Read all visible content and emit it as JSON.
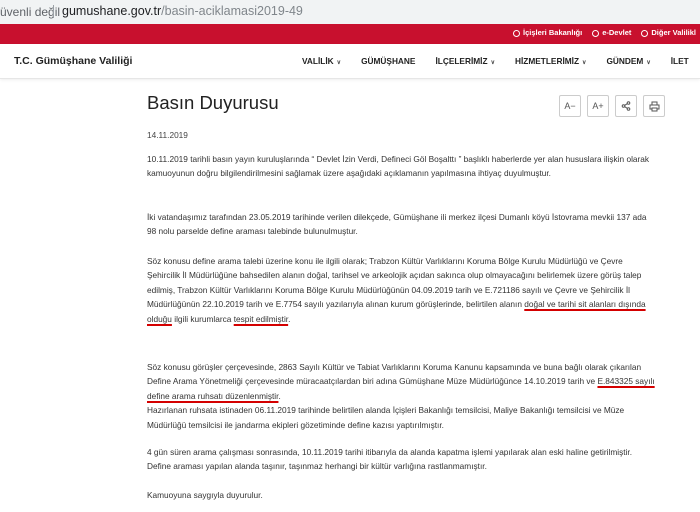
{
  "browser": {
    "security_text": "üvenli değil",
    "url_domain": "gumushane.gov.tr",
    "url_path": "/basin-aciklamasi2019-49"
  },
  "topbar": {
    "links": [
      "İçişleri Bakanlığı",
      "e-Devlet",
      "Diğer Valilikl"
    ]
  },
  "nav": {
    "brand": "T.C. Gümüşhane Valiliği",
    "items": [
      "VALİLİK",
      "GÜMÜŞHANE",
      "İLÇELERİMİZ",
      "HİZMETLERİMİZ",
      "GÜNDEM",
      "İLET"
    ]
  },
  "article": {
    "title": "Basın Duyurusu",
    "date": "14.11.2019",
    "tools": [
      "A−",
      "A+"
    ],
    "p1": "10.11.2019 tarihli basın yayın kuruluşlarında “ Devlet İzin Verdi, Defineci Göl Boşalttı ” başlıklı haberlerde yer alan hususlara ilişkin olarak kamuoyunun doğru bilgilendirilmesini sağlamak üzere aşağıdaki açıklamanın yapılmasına ihtiyaç duyulmuştur.",
    "p2": "İki vatandaşımız tarafından 23.05.2019 tarihinde verilen dilekçede, Gümüşhane ili merkez ilçesi Dumanlı köyü İstovrama mevkii 137 ada 98 nolu parselde define araması talebinde bulunulmuştur.",
    "p3_a": "Söz konusu define arama talebi üzerine konu ile ilgili olarak; Trabzon Kültür Varlıklarını Koruma Bölge Kurulu Müdürlüğü ve Çevre Şehircilik İl Müdürlüğüne bahsedilen alanın doğal, tarihsel ve arkeolojik açıdan sakınca olup olmayacağını belirlemek üzere görüş talep edilmiş, Trabzon Kültür Varlıklarını Koruma Bölge Kurulu Müdürlüğünün 04.09.2019 tarih ve E.721186 sayılı ve Çevre ve Şehircilik İl Müdürlüğünün 22.10.2019 tarih ve E.7754 sayılı yazılarıyla alınan kurum görüşlerinde, belirtilen alanın ",
    "p3_u1": "doğal ve tarihi sit alanları dışında olduğu",
    "p3_b": " ilgili kurumlarca ",
    "p3_u2": "tespit edilmiştir",
    "p3_c": ".",
    "p4_a": "Söz konusu görüşler çerçevesinde, 2863 Sayılı Kültür ve Tabiat Varlıklarını Koruma Kanunu kapsamında ve buna bağlı olarak çıkarılan Define Arama Yönetmeliği çerçevesinde müracaatçılardan biri adına Gümüşhane Müze Müdürlüğünce  14.10.2019 tarih ve ",
    "p4_u": "E.843325 sayılı define arama ruhsatı düzenlenmiştir",
    "p4_b": ".",
    "p4_c": "Hazırlanan ruhsata istinaden 06.11.2019 tarihinde belirtilen alanda İçişleri Bakanlığı temsilcisi, Maliye Bakanlığı temsilcisi ve Müze Müdürlüğü temsilcisi ile jandarma ekipleri gözetiminde define kazısı yaptırılmıştır.",
    "p5": "4 gün süren arama çalışması sonrasında, 10.11.2019 tarihi itibarıyla da alanda kapatma işlemi yapılarak alan eski haline getirilmiştir. Define araması yapılan alanda taşınır, taşınmaz herhangi bir kültür varlığına rastlanmamıştır.",
    "p6": "Kamuoyuna saygıyla duyurulur."
  },
  "colors": {
    "brand_red": "#c8102e",
    "annotation_red": "#d40000"
  }
}
